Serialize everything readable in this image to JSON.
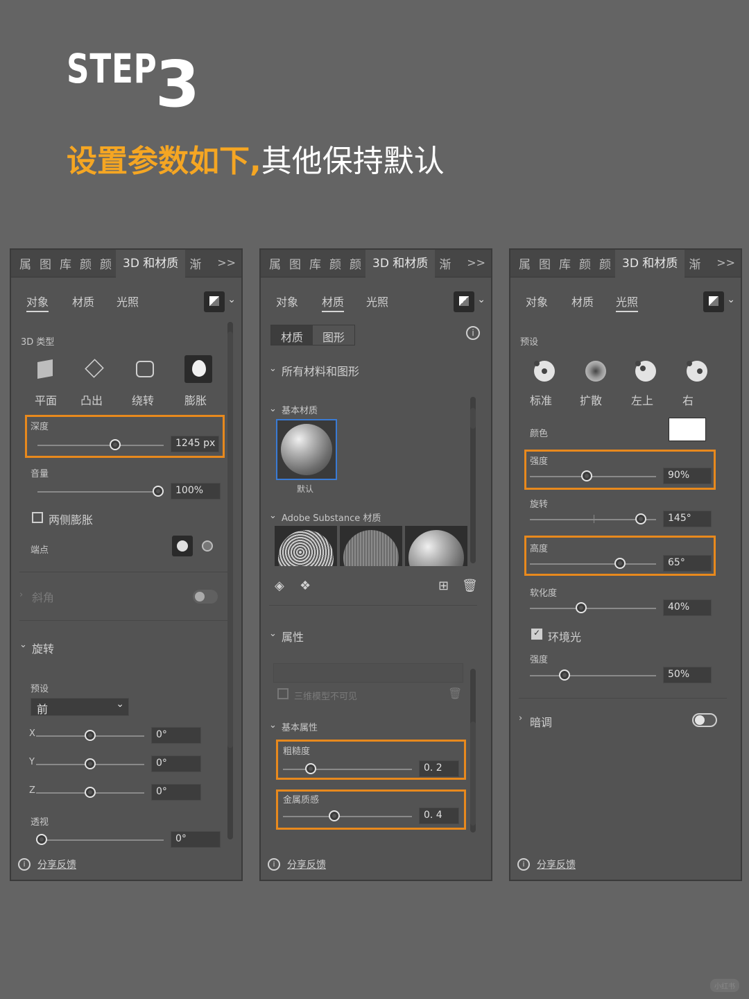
{
  "header": {
    "step_word": "STEP",
    "step_number": "3",
    "subtitle_highlight": "设置参数如下,",
    "subtitle_rest": "其他保持默认"
  },
  "colors": {
    "accent_orange": "#e8891d",
    "title_orange": "#f5a623",
    "bg": "#646464",
    "panel": "#535353"
  },
  "tabs": [
    "属",
    "图",
    "库",
    "颜",
    "颜",
    "3D 和材质",
    "渐",
    ">>"
  ],
  "subtabs": [
    "对象",
    "材质",
    "光照"
  ],
  "footer": {
    "feedback": "分享反馈"
  },
  "panel1": {
    "type_label": "3D 类型",
    "types": [
      "平面",
      "凸出",
      "绕转",
      "膨胀"
    ],
    "depth_label": "深度",
    "depth_value": "1245 px",
    "volume_label": "音量",
    "volume_value": "100%",
    "both_sides": "两侧膨胀",
    "endpoints": "端点",
    "bevel": "斜角",
    "rotation": "旋转",
    "preset_label": "预设",
    "preset_value": "前",
    "x_label": "X",
    "x_value": "0°",
    "y_label": "Y",
    "y_value": "0°",
    "z_label": "Z",
    "z_value": "0°",
    "perspective_label": "透视",
    "perspective_value": "0°"
  },
  "panel2": {
    "seg": [
      "材质",
      "图形"
    ],
    "all_materials": "所有材料和图形",
    "basic_materials": "基本材质",
    "default_label": "默认",
    "substance": "Adobe Substance 材质",
    "properties": "属性",
    "invisible": "三维模型不可见",
    "basic_props": "基本属性",
    "roughness_label": "粗糙度",
    "roughness_value": "0. 2",
    "metallic_label": "金属质感",
    "metallic_value": "0. 4"
  },
  "panel3": {
    "preset_label": "预设",
    "presets": [
      "标准",
      "扩散",
      "左上",
      "右"
    ],
    "color_label": "颜色",
    "intensity_label": "强度",
    "intensity_value": "90%",
    "rotation_label": "旋转",
    "rotation_value": "145°",
    "height_label": "高度",
    "height_value": "65°",
    "softness_label": "软化度",
    "softness_value": "40%",
    "ambient_label": "环境光",
    "ambient_intensity_label": "强度",
    "ambient_intensity_value": "50%",
    "shadow_label": "暗调"
  },
  "watermark": "小红书"
}
